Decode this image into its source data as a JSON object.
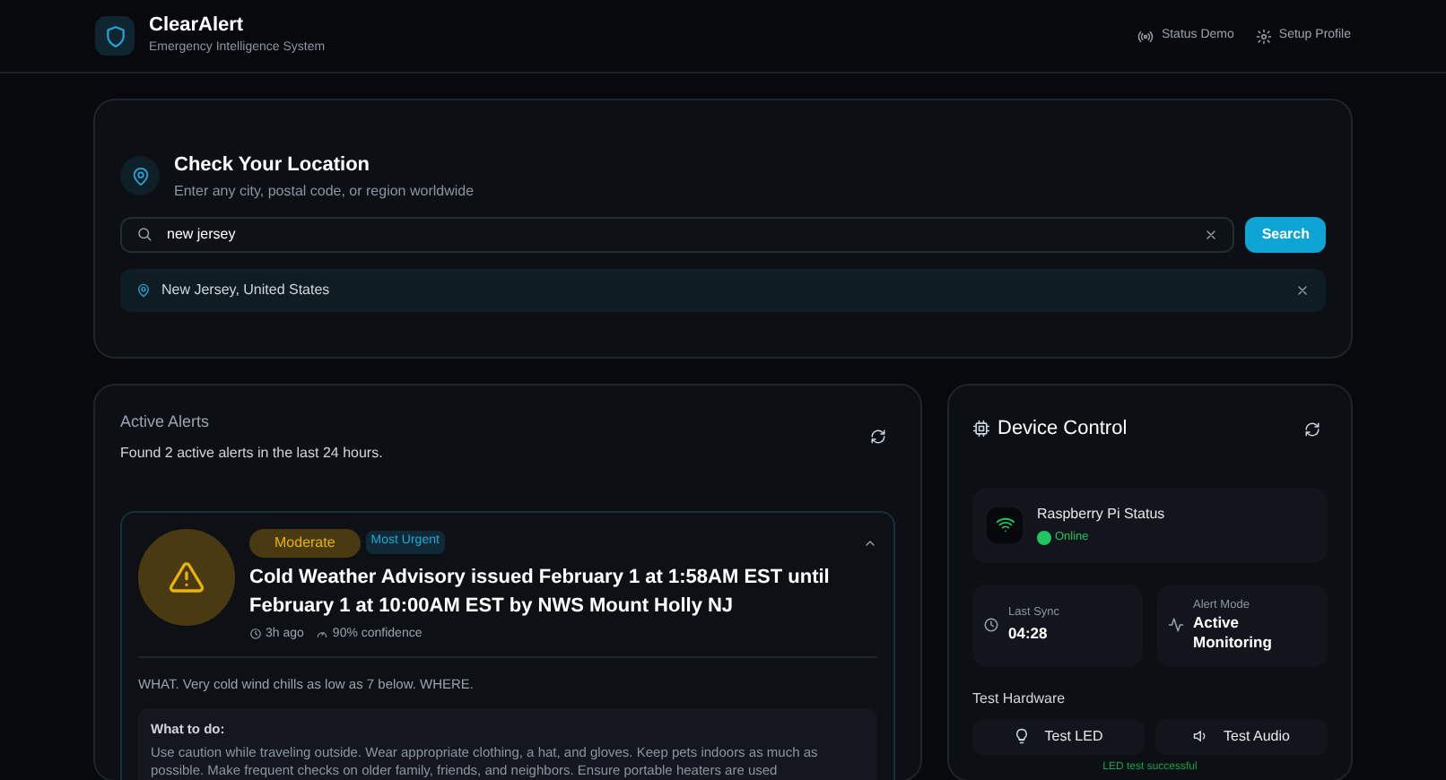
{
  "header": {
    "title": "ClearAlert",
    "subtitle": "Emergency Intelligence System",
    "nav": [
      "Status Demo",
      "Setup Profile"
    ]
  },
  "location": {
    "title": "Check Your Location",
    "subtitle": "Enter any city, postal code, or region worldwide",
    "search_value": "new jersey",
    "search_button": "Search",
    "selected": "New Jersey, United States"
  },
  "alerts": {
    "title": "Active Alerts",
    "summary": "Found 2 active alerts in the last 24 hours.",
    "items": [
      {
        "severity": "Moderate",
        "badge": "Most Urgent",
        "title": "Cold Weather Advisory issued February 1 at 1:58AM EST until February 1 at 10:00AM EST by NWS Mount Holly NJ",
        "time": "3h ago",
        "confidence": "90% confidence",
        "expanded": true,
        "description": "WHAT. Very cold wind chills as low as 7 below. WHERE.",
        "instructions_title": "What to do:",
        "instructions": "Use caution while traveling outside. Wear appropriate clothing, a hat, and gloves. Keep pets indoors as much as possible. Make frequent checks on older family, friends, and neighbors. Ensure portable heaters are used"
      }
    ]
  },
  "device": {
    "title": "Device Control",
    "status_label": "Raspberry Pi Status",
    "status": "Online",
    "online": true,
    "last_sync_label": "Last Sync",
    "last_sync": "04:28",
    "mode_label": "Alert Mode",
    "mode": "Active Monitoring",
    "test_title": "Test Hardware",
    "buttons": [
      {
        "kind": "led",
        "label": "Test LED"
      },
      {
        "kind": "audio",
        "label": "Test Audio"
      }
    ],
    "result": "LED test successful"
  }
}
